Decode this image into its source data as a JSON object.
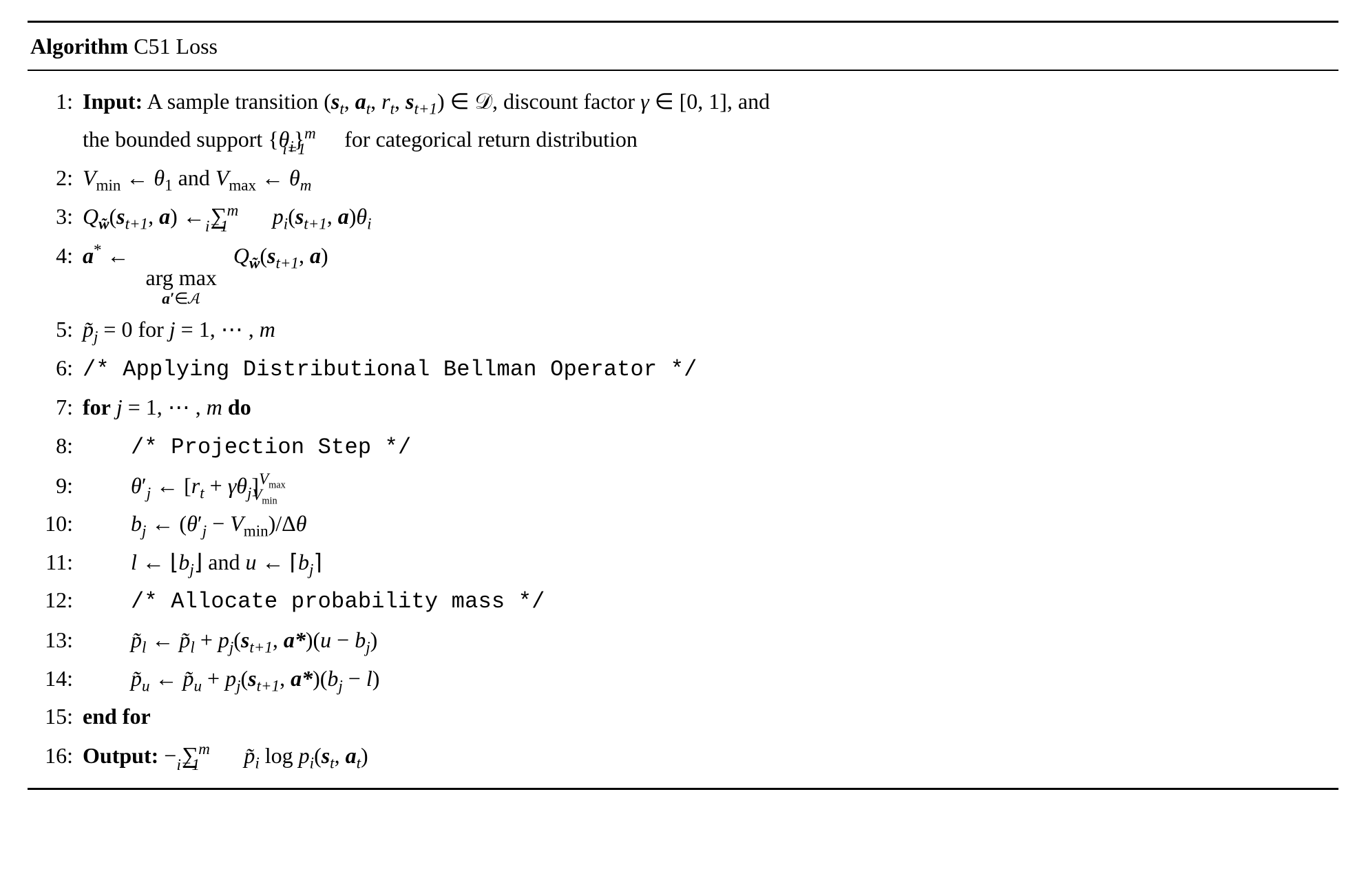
{
  "title_prefix": "Algorithm",
  "title": "C51 Loss",
  "lines": {
    "n1": "1:",
    "n2": "2:",
    "n3": "3:",
    "n4": "4:",
    "n5": "5:",
    "n6": "6:",
    "n7": "7:",
    "n8": "8:",
    "n9": "9:",
    "n10": "10:",
    "n11": "11:",
    "n12": "12:",
    "n13": "13:",
    "n14": "14:",
    "n15": "15:",
    "n16": "16:"
  },
  "kw": {
    "input": "Input:",
    "output": "Output:",
    "for": "for",
    "do": "do",
    "endfor": "end for",
    "and": "and"
  },
  "text": {
    "l1a": "A sample transition (",
    "l1b": ") ∈ 𝒟, discount factor ",
    "l1c": " ∈ [0, 1], and",
    "l1d": "the bounded support {",
    "l1e": " for categorical return distribution",
    "l5b": " = 0 for ",
    "l5c": " = 1, ⋯ , ",
    "l6": "/* Applying Distributional Bellman Operator */",
    "l7b": " = 1, ⋯ , ",
    "l8": "/* Projection Step */",
    "l12": "/* Allocate probability mass */"
  },
  "math": {
    "s": "s",
    "a": "a",
    "r": "r",
    "t": "t",
    "tp1": "t+1",
    "gamma": "γ",
    "theta": "θ",
    "Delta": "Δ",
    "i": "i",
    "j": "j",
    "m": "m",
    "l": "l",
    "u": "u",
    "p": "p",
    "ptilde": "p̃",
    "b": "b",
    "Q": "Q",
    "w": "w̃",
    "V": "V",
    "min": "min",
    "max": "max",
    "astar": "a*",
    "aprime": "a′",
    "A": "𝒜",
    "argmax": "arg max",
    "arrow": "←",
    "sum": "∑",
    "i1": "i=1",
    "floorL": "⌊",
    "floorR": "⌋",
    "ceilL": "⌈",
    "ceilR": "⌉",
    "to_m": "}",
    "brL": "[",
    "brR": "]",
    "log": "log",
    "minus": "−"
  }
}
